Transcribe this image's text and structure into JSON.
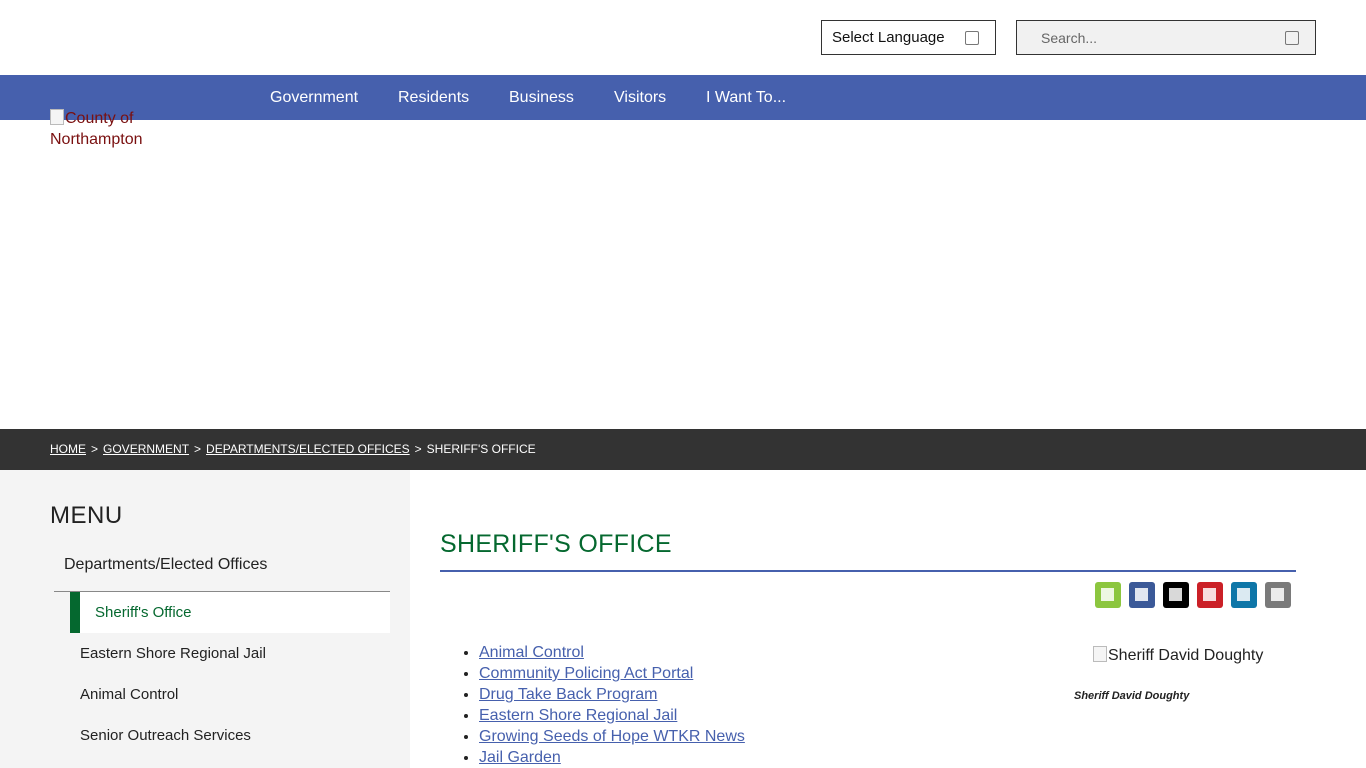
{
  "header": {
    "language_select": "Select Language",
    "search_placeholder": "Search..."
  },
  "nav": {
    "items": [
      "Government",
      "Residents",
      "Business",
      "Visitors",
      "I Want To..."
    ]
  },
  "logo": {
    "alt_text": "County of Northampton"
  },
  "breadcrumb": {
    "items": [
      "HOME",
      "GOVERNMENT",
      "DEPARTMENTS/ELECTED OFFICES"
    ],
    "current": "SHERIFF'S OFFICE",
    "separator": ">"
  },
  "sidebar": {
    "title": "MENU",
    "parent": "Departments/Elected Offices",
    "active": "Sheriff's Office",
    "items": [
      "Eastern Shore Regional Jail",
      "Animal Control",
      "Senior Outreach Services"
    ]
  },
  "main": {
    "title": "SHERIFF'S OFFICE",
    "share_icons": [
      {
        "name": "print-icon",
        "color": "#8cc63f"
      },
      {
        "name": "facebook-icon",
        "color": "#3b5998"
      },
      {
        "name": "x-twitter-icon",
        "color": "#000000"
      },
      {
        "name": "pinterest-icon",
        "color": "#cb2027"
      },
      {
        "name": "linkedin-icon",
        "color": "#0e76a8"
      },
      {
        "name": "email-icon",
        "color": "#7a7a7a"
      }
    ],
    "links": [
      "Animal Control",
      "Community Policing Act Portal",
      "Drug Take Back Program",
      "Eastern Shore Regional Jail",
      "Growing Seeds of Hope WTKR News",
      "Jail Garden"
    ],
    "sheriff_image_alt": "Sheriff David Doughty",
    "sheriff_caption": "Sheriff David Doughty"
  },
  "colors": {
    "nav_blue": "#4660ad",
    "accent_green": "#05682f",
    "breadcrumb_bg": "#333333",
    "logo_text": "#7a1010"
  }
}
